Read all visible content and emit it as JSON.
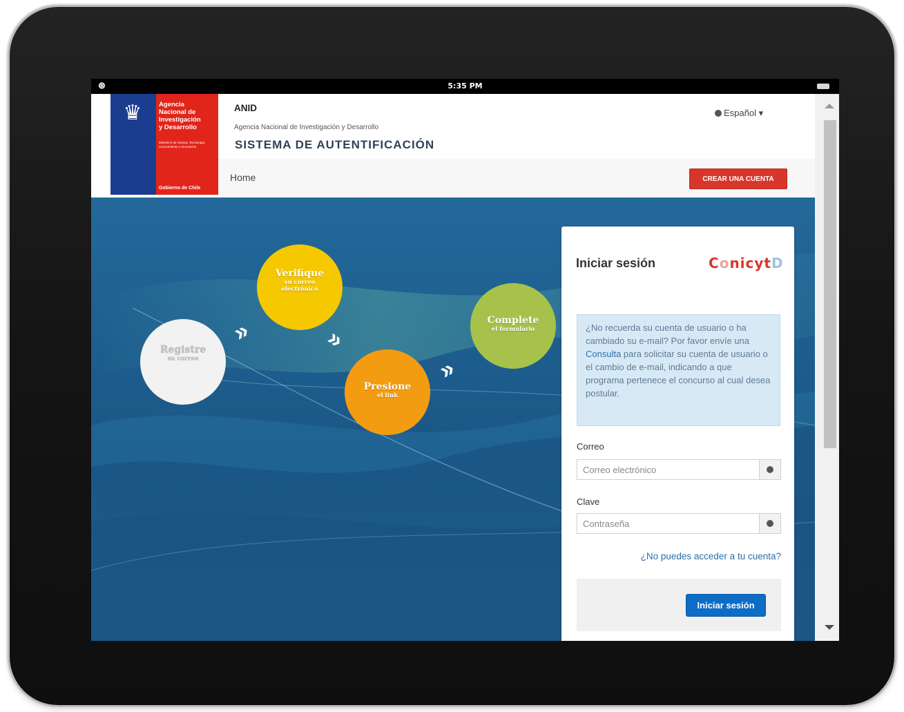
{
  "status_bar": {
    "time": "5:35 PM"
  },
  "header": {
    "logo": {
      "agency_lines": [
        "Agencia",
        "Nacional de",
        "Investigación",
        "y Desarrollo"
      ],
      "ministry_line": "Ministerio de Ciencia, Tecnología, Conocimiento e Innovación",
      "government": "Gobierno de Chile"
    },
    "title": "ANID",
    "subtitle": "Agencia Nacional de Investigación y Desarrollo",
    "system": "SISTEMA DE AUTENTIFICACIÓN",
    "language": "Español",
    "nav_home": "Home",
    "create_account": "CREAR UNA CUENTA"
  },
  "hero": {
    "steps": [
      {
        "main": "Registre",
        "sub": "su correo",
        "color": "#f2f2f2"
      },
      {
        "main": "Verifique",
        "sub": "su correo",
        "sub2": "electrónico",
        "color": "#f5c800"
      },
      {
        "main": "Presione",
        "sub": "el link",
        "color": "#f39c12"
      },
      {
        "main": "Complete",
        "sub": "el formulario",
        "color": "#a6c24a"
      }
    ],
    "arrow": "»"
  },
  "login": {
    "title": "Iniciar sesión",
    "brand": "ConicytD",
    "info_before": "¿No recuerda su cuenta de usuario o ha cambiado su e-mail? Por favor envíe una ",
    "info_link": "Consulta",
    "info_after": " para solicitar su cuenta de usuario o el cambio de e-mail, indicando a que programa pertenece el concurso al cual desea postular.",
    "email_label": "Correo",
    "email_placeholder": "Correo electrónico",
    "password_label": "Clave",
    "password_placeholder": "Contraseña",
    "forgot": "¿No puedes acceder a tu cuenta?",
    "submit": "Iniciar sesión"
  },
  "colors": {
    "accent_red": "#d9362b",
    "primary_blue": "#0d6dc6",
    "hero_blue": "#1e5f8f"
  }
}
